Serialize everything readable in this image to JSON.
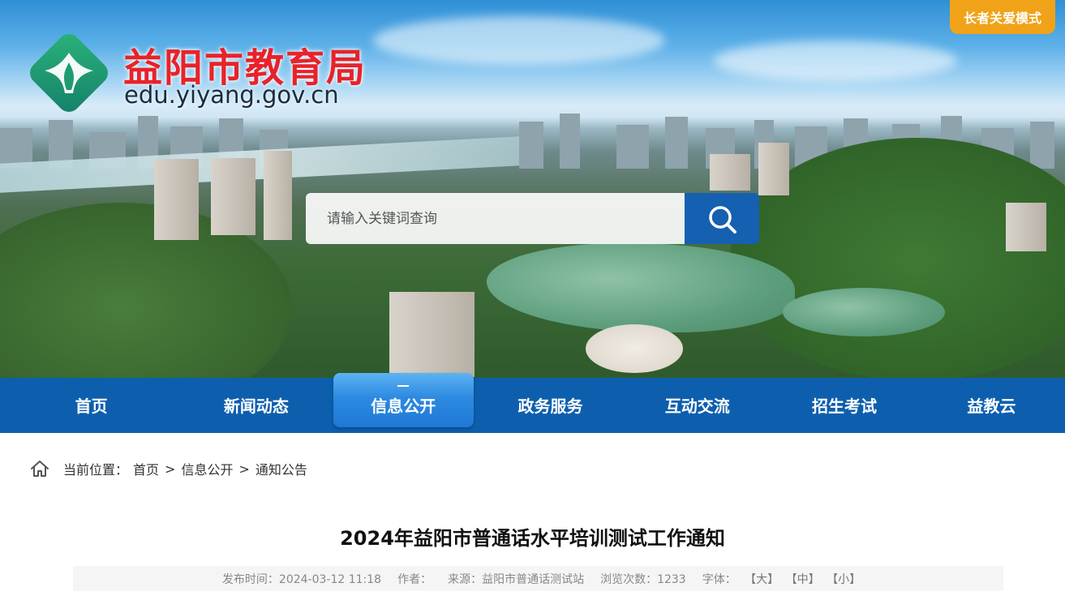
{
  "header": {
    "site_title": "益阳市教育局",
    "site_domain": "edu.yiyang.gov.cn",
    "care_mode_label": "长者关爱模式"
  },
  "search": {
    "placeholder": "请输入关键词查询"
  },
  "nav": {
    "items": [
      {
        "label": "首页"
      },
      {
        "label": "新闻动态"
      },
      {
        "label": "信息公开"
      },
      {
        "label": "政务服务"
      },
      {
        "label": "互动交流"
      },
      {
        "label": "招生考试"
      },
      {
        "label": "益教云"
      }
    ],
    "active": "信息公开"
  },
  "breadcrumb": {
    "prefix": "当前位置：",
    "items": [
      "首页",
      "信息公开",
      "通知公告"
    ],
    "separator": ">"
  },
  "article": {
    "title": "2024年益阳市普通话水平培训测试工作通知",
    "publish_label": "发布时间：",
    "publish_time": "2024-03-12 11:18",
    "author_label": "作者：",
    "author": "",
    "source_label": "来源：",
    "source": "益阳市普通话测试站",
    "views_label": "浏览次数：",
    "views": "1233",
    "font_label": "字体：",
    "font_large": "【大】",
    "font_medium": "【中】",
    "font_small": "【小】"
  },
  "colors": {
    "nav_bg": "#0d5fae",
    "accent_orange": "#f0a318",
    "title_red": "#e8222a",
    "search_btn": "#1560b0"
  },
  "icons": [
    "logo-emblem",
    "search-icon",
    "home-icon"
  ]
}
